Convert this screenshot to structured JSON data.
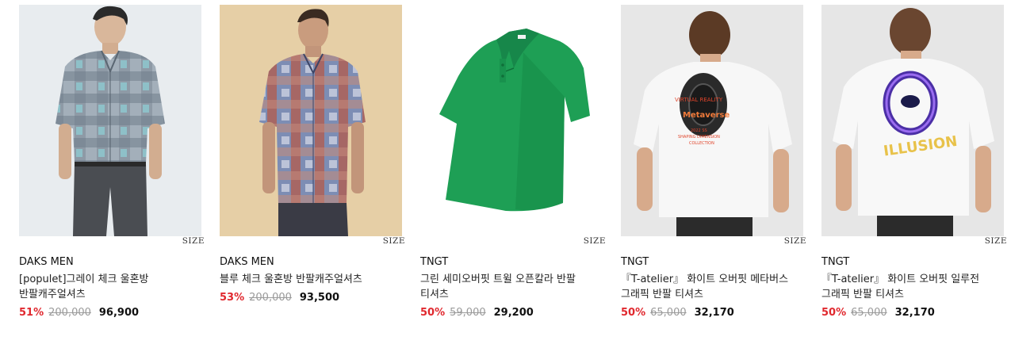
{
  "products": [
    {
      "brand": "DAKS MEN",
      "name": "[populet]그레이 체크 울혼방 반팔캐주얼셔츠",
      "size_label": "SIZE",
      "discount": "51%",
      "original_price": "200,000",
      "final_price": "96,900",
      "image": "gray-check-short-sleeve-shirt-model"
    },
    {
      "brand": "DAKS MEN",
      "name": "블루 체크 울혼방 반팔캐주얼셔츠",
      "size_label": "SIZE",
      "discount": "53%",
      "original_price": "200,000",
      "final_price": "93,500",
      "image": "blue-red-check-short-sleeve-shirt-model"
    },
    {
      "brand": "TNGT",
      "name": "그린 세미오버핏 트윌 오픈칼라 반팔 티셔츠",
      "size_label": "SIZE",
      "discount": "50%",
      "original_price": "59,000",
      "final_price": "29,200",
      "image": "green-open-collar-polo-flatlay"
    },
    {
      "brand": "TNGT",
      "name": "『T-atelier』 화이트 오버핏 메타버스 그래픽 반팔 티셔츠",
      "size_label": "SIZE",
      "discount": "50%",
      "original_price": "65,000",
      "final_price": "32,170",
      "image": "white-metaverse-graphic-tee-back",
      "graphic_text": [
        "VIRTUAL REALITY",
        "Metaverse",
        "2022 SS",
        "SHAPING DIMENSION",
        "COLLECTION"
      ]
    },
    {
      "brand": "TNGT",
      "name": "『T-atelier』 화이트 오버핏 일루전 그래픽 반팔 티셔츠",
      "size_label": "SIZE",
      "discount": "50%",
      "original_price": "65,000",
      "final_price": "32,170",
      "image": "white-illusion-graphic-tee-back",
      "graphic_text": [
        "ILLUSION"
      ]
    }
  ],
  "colors": {
    "discount": "#e0282e",
    "original_price": "#9a9a9a",
    "text": "#111111"
  }
}
